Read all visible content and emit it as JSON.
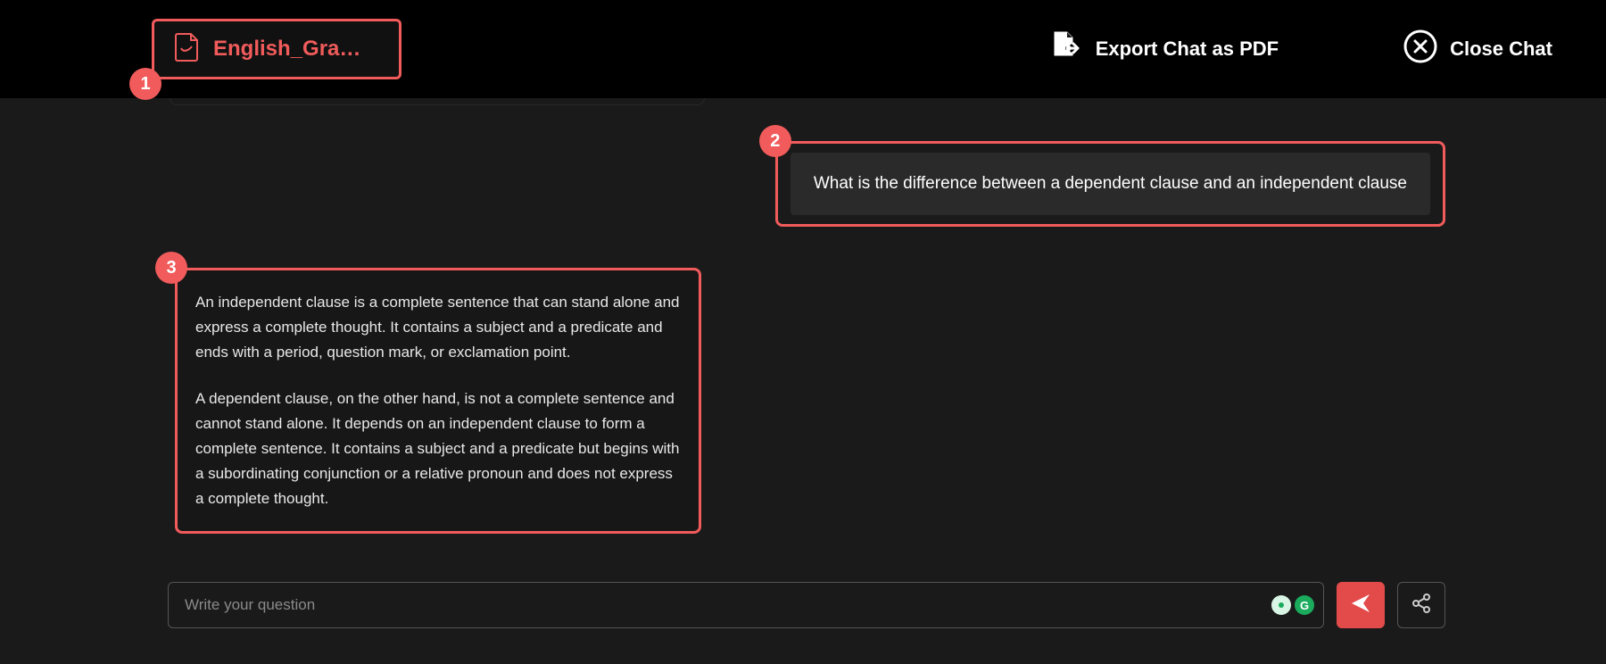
{
  "header": {
    "file_name": "English_Grammar…",
    "export_label": "Export Chat as PDF",
    "close_label": "Close Chat"
  },
  "annotations": {
    "file_badge": "1",
    "user_msg_badge": "2",
    "bot_msg_badge": "3"
  },
  "messages": {
    "user_1": "What is the difference between a dependent clause and an independent clause",
    "bot_1_p1": "An independent clause is a complete sentence that can stand alone and express a complete thought. It contains a subject and a predicate and ends with a period, question mark, or exclamation point.",
    "bot_1_p2": "A dependent clause, on the other hand, is not a complete sentence and cannot stand alone. It depends on an independent clause to form a complete sentence. It contains a subject and a predicate but begins with a subordinating conjunction or a relative pronoun and does not express a complete thought."
  },
  "composer": {
    "placeholder": "Write your question",
    "grammarly_label": "G"
  },
  "colors": {
    "accent": "#f15b5b",
    "background": "#1a1a1a"
  }
}
